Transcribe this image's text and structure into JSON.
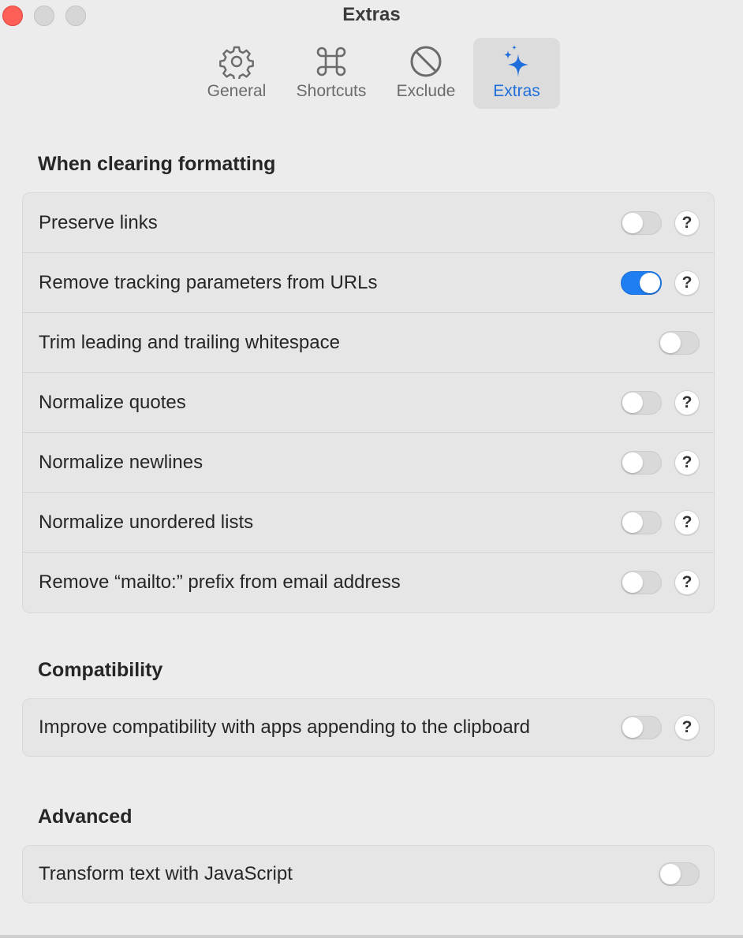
{
  "window": {
    "title": "Extras"
  },
  "tabs": [
    {
      "label": "General",
      "icon": "gear-icon",
      "active": false
    },
    {
      "label": "Shortcuts",
      "icon": "command-icon",
      "active": false
    },
    {
      "label": "Exclude",
      "icon": "prohibited-icon",
      "active": false
    },
    {
      "label": "Extras",
      "icon": "sparkles-icon",
      "active": true
    }
  ],
  "colors": {
    "accent": "#1e6fd9",
    "toggle_on": "#1f7ef1",
    "close": "#fe5f57"
  },
  "sections": {
    "formatting": {
      "title": "When clearing formatting",
      "rows": [
        {
          "label": "Preserve links",
          "on": false,
          "help": "?"
        },
        {
          "label": "Remove tracking parameters from URLs",
          "on": true,
          "help": "?"
        },
        {
          "label": "Trim leading and trailing whitespace",
          "on": false
        },
        {
          "label": "Normalize quotes",
          "on": false,
          "help": "?"
        },
        {
          "label": "Normalize newlines",
          "on": false,
          "help": "?"
        },
        {
          "label": "Normalize unordered lists",
          "on": false,
          "help": "?"
        },
        {
          "label": "Remove “mailto:” prefix from email address",
          "on": false,
          "help": "?"
        }
      ]
    },
    "compatibility": {
      "title": "Compatibility",
      "rows": [
        {
          "label": "Improve compatibility with apps appending to the clipboard",
          "on": false,
          "help": "?"
        }
      ]
    },
    "advanced": {
      "title": "Advanced",
      "rows": [
        {
          "label": "Transform text with JavaScript",
          "on": false
        }
      ]
    }
  }
}
